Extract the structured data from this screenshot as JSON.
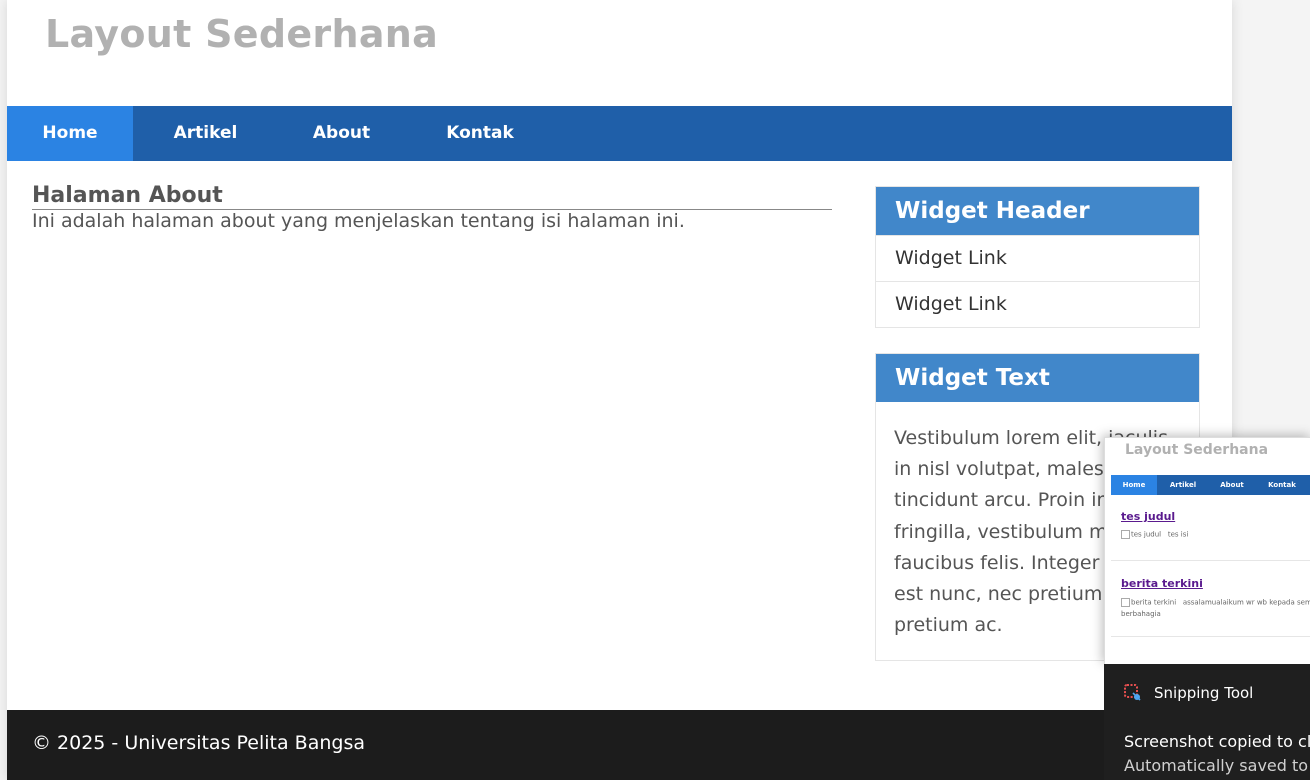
{
  "site": {
    "title": "Layout Sederhana"
  },
  "nav": {
    "items": [
      {
        "label": "Home",
        "active": true
      },
      {
        "label": "Artikel",
        "active": false
      },
      {
        "label": "About",
        "active": false
      },
      {
        "label": "Kontak",
        "active": false
      }
    ]
  },
  "content": {
    "heading": "Halaman About",
    "body": "Ini adalah halaman about yang menjelaskan tentang isi halaman ini."
  },
  "widgets": {
    "links": {
      "header": "Widget Header",
      "items": [
        "Widget Link",
        "Widget Link"
      ]
    },
    "text": {
      "header": "Widget Text",
      "body": "Vestibulum lorem elit, iaculis\nin nisl volutpat, males\ntincidunt arcu. Proin in\nfringilla, vestibulum m\nfaucibus felis. Integer\nest nunc, nec pretium\npretium ac."
    }
  },
  "footer": {
    "copyright": "© 2025 - Universitas Pelita Bangsa"
  },
  "snip_preview": {
    "title": "Layout Sederhana",
    "nav": [
      "Home",
      "Artikel",
      "About",
      "Kontak"
    ],
    "posts": [
      {
        "title": "tes judul",
        "image_alt": "tes judul",
        "excerpt": "tes isi"
      },
      {
        "title": "berita terkini",
        "image_alt": "berita terkini",
        "excerpt": "assalamualaikum wr wb kepada semua",
        "excerpt2": "berbahagia"
      }
    ]
  },
  "toast": {
    "app": "Snipping Tool",
    "message": "Screenshot copied to cli",
    "sub": "Automatically saved to s"
  },
  "colors": {
    "nav_bg": "#1f5fa9",
    "nav_active": "#2b83e3",
    "widget_header": "#4187ca",
    "footer_bg": "#1c1c1c",
    "title_gray": "#b1b1b1"
  }
}
